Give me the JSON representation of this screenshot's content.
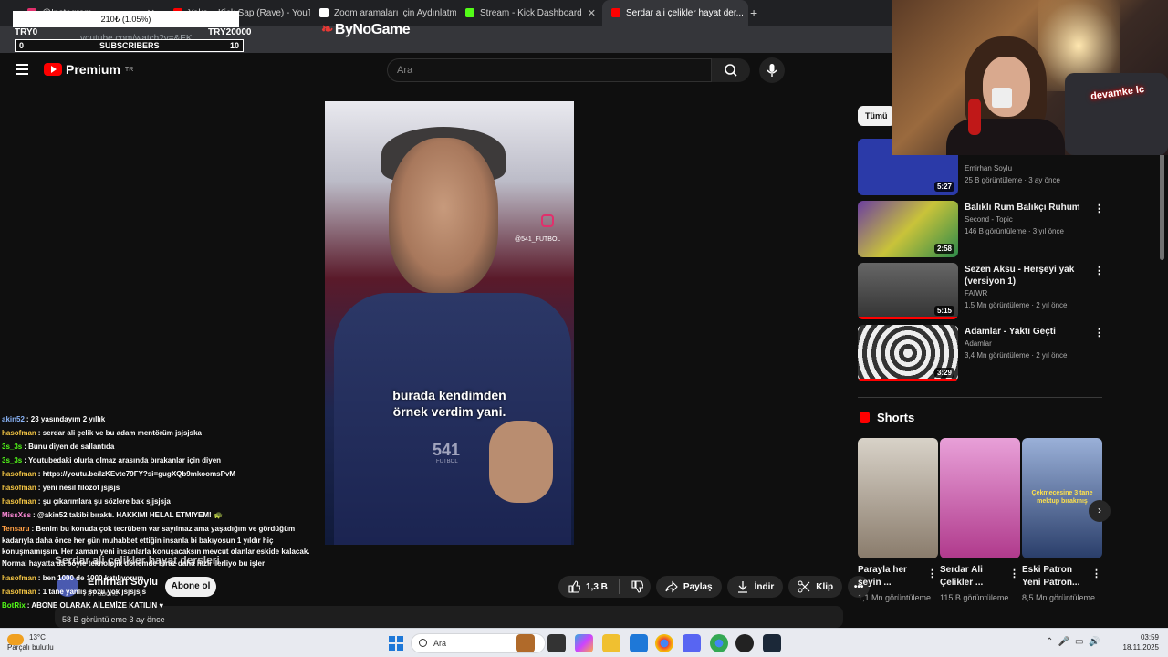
{
  "browser": {
    "tabs": [
      {
        "label": "@Instagram",
        "favicon_color": "#e1306c",
        "active": false
      },
      {
        "label": "Yeka... Kick Sap (Rave) - YouTube",
        "favicon_color": "#ff0000",
        "active": false
      },
      {
        "label": "Zoom aramaları için Aydınlatm...",
        "favicon_color": "#ffffff",
        "active": false
      },
      {
        "label": "Stream - Kick Dashboard",
        "favicon_color": "#53fc18",
        "active": false
      },
      {
        "label": "Serdar ali çelikler hayat der...",
        "favicon_color": "#ff0000",
        "active": true
      }
    ],
    "url": "youtube.com/watch?v=&EK...",
    "brand": "ByNoGame"
  },
  "overlay": {
    "goal_label": "210₺ (1.05%)",
    "goal_left": "TRY0",
    "goal_right": "TRY20000",
    "subs_left": "0",
    "subs_center": "SUBSCRIBERS",
    "subs_right": "10"
  },
  "youtube": {
    "logo_text": "Premium",
    "region": "TR",
    "search_placeholder": "Ara",
    "video": {
      "handle": "@541_FUTBOL",
      "caption_line1": "burada kendimden",
      "caption_line2": "örnek verdim yani.",
      "watermark": "541",
      "watermark_sub": "FUTBOL",
      "title": "Serdar ali çelikler hayat dersleri",
      "channel": "Emirhan Soylu",
      "channel_subs": "87 abone",
      "subscribe_label": "Abone ol",
      "views": "58 B görüntüleme  3 ay önce",
      "likes": "1,3 B",
      "share_label": "Paylaş",
      "download_label": "İndir",
      "clip_label": "Klip"
    },
    "filter_chip": "Tümü",
    "recommendations": [
      {
        "title": "",
        "channel": "Emirhan Soylu",
        "meta": "25 B görüntüleme · 3 ay önce",
        "duration": "5:27",
        "thumb_color": "#2b3aa8"
      },
      {
        "title": "Balıklı Rum Balıkçı Ruhum",
        "channel": "Second - Topic",
        "meta": "146 B görüntüleme · 3 yıl önce",
        "duration": "2:58",
        "thumb_color": "#6b3ea0"
      },
      {
        "title": "Sezen Aksu - Herşeyi yak (versiyon 1)",
        "channel": "FAIWR",
        "meta": "1,5 Mn görüntüleme · 2 yıl önce",
        "duration": "5:15",
        "thumb_color": "#4a4a4a"
      },
      {
        "title": "Adamlar - Yaktı Geçti",
        "channel": "Adamlar",
        "meta": "3,4 Mn görüntüleme · 2 yıl önce",
        "duration": "3:29",
        "thumb_color": "#d9d9d9"
      }
    ],
    "shorts_title": "Shorts",
    "shorts": [
      {
        "title": "Parayla her şeyin ...",
        "views": "1,1 Mn görüntüleme",
        "thumb_color": "#8a7c6c"
      },
      {
        "title": "Serdar Ali Çelikler ...",
        "views": "115 B görüntüleme",
        "thumb_color": "#b03a8c"
      },
      {
        "title": "Eski Patron Yeni Patron...",
        "views": "8,5 Mn görüntüleme",
        "thumb_color": "#2a3e6a"
      }
    ],
    "short_overlay_text": "Çekmecesine 3 tane mektup bırakmış"
  },
  "chat": [
    {
      "user": "akin52",
      "color": "#8ab4f8",
      "text": "23 yasındayım 2 yıllık"
    },
    {
      "user": "hasofman",
      "color": "#f6c744",
      "text": "serdar ali çelik ve bu adam mentörüm jsjsjska"
    },
    {
      "user": "3s_3s",
      "color": "#53fc18",
      "text": "Bunu diyen de sallantıda"
    },
    {
      "user": "3s_3s",
      "color": "#53fc18",
      "text": "Youtubedaki olurla olmaz arasında bırakanlar için diyen"
    },
    {
      "user": "hasofman",
      "color": "#f6c744",
      "text": "https://youtu.be/IzKEvte79FY?si=gugXQb9mkoomsPvM"
    },
    {
      "user": "hasofman",
      "color": "#f6c744",
      "text": "yeni nesil filozof jsjsjs"
    },
    {
      "user": "hasofman",
      "color": "#f6c744",
      "text": "şu çıkarımlara şu sözlere bak sjjsjsja"
    },
    {
      "user": "MissXss",
      "color": "#ff8ad8",
      "text": "@akin52 takibi bıraktı. HAKKIMI HELAL ETMIYEM! 🐢"
    },
    {
      "user": "Tensaru",
      "color": "#ff9f43",
      "text": "Benim bu konuda çok tecrübem var sayılmaz ama yaşadığım ve gördüğüm kadarıyla daha önce her gün muhabbet ettiğin insanla bi bakıyosun 1 yıldır hiç konuşmamışsın. Her zaman yeni insanlarla konuşacaksın mevcut olanlar eskide kalacak. Normal hayatta da böyle teknolojik dönemde biraz daha hızlı ilerliyo bu işler"
    },
    {
      "user": "hasofman",
      "color": "#f6c744",
      "text": "ben 1000 de 1000 katılıyorum"
    },
    {
      "user": "hasofman",
      "color": "#f6c744",
      "text": "1 tane yanlış sözü yok jsjsjsjs"
    },
    {
      "user": "BotRix",
      "color": "#53fc18",
      "text": "ABONE OLARAK AİLEMİZE KATILIN ♥"
    }
  ],
  "webcam": {
    "sign_text": "devamke lc"
  },
  "taskbar": {
    "temperature": "13°C",
    "weather_text": "Parçalı bulutlu",
    "search_placeholder": "Ara",
    "time": "03:59",
    "date": "18.11.2025"
  }
}
